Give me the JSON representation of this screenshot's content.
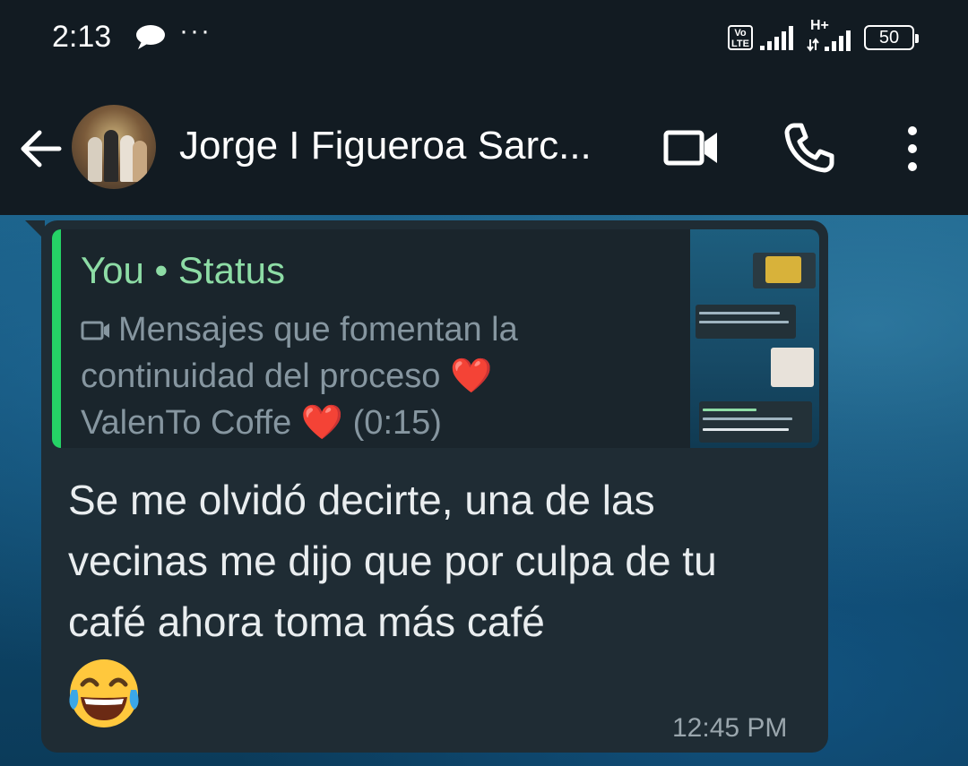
{
  "status_bar": {
    "time": "2:13",
    "notification_icons": [
      "chat-bubble-icon",
      "more-dots-icon"
    ],
    "volte_label": "Vo\nLTE",
    "network_label": "H+",
    "battery_level": "50"
  },
  "header": {
    "contact_name": "Jorge I Figueroa Sarc...",
    "icons": [
      "back-arrow-icon",
      "video-call-icon",
      "phone-icon",
      "more-vert-icon"
    ]
  },
  "message": {
    "quoted": {
      "author": "You • Status",
      "media_icon": "video-icon",
      "text_line1": "Mensajes que fomentan la",
      "text_line2": "continuidad del proceso",
      "text_line3": "ValenTo Coffe",
      "heart": "❤️",
      "duration": "(0:15)"
    },
    "text": "Se me olvidó decirte, una de las vecinas me dijo que por culpa de tu café ahora toma más café",
    "emoji": "😂",
    "time": "12:45 PM"
  },
  "colors": {
    "header_bg": "#121b22",
    "bubble_bg": "#1f2c34",
    "quote_accent": "#25d366",
    "quote_author": "#8ddca5",
    "heart": "#e3343c"
  }
}
